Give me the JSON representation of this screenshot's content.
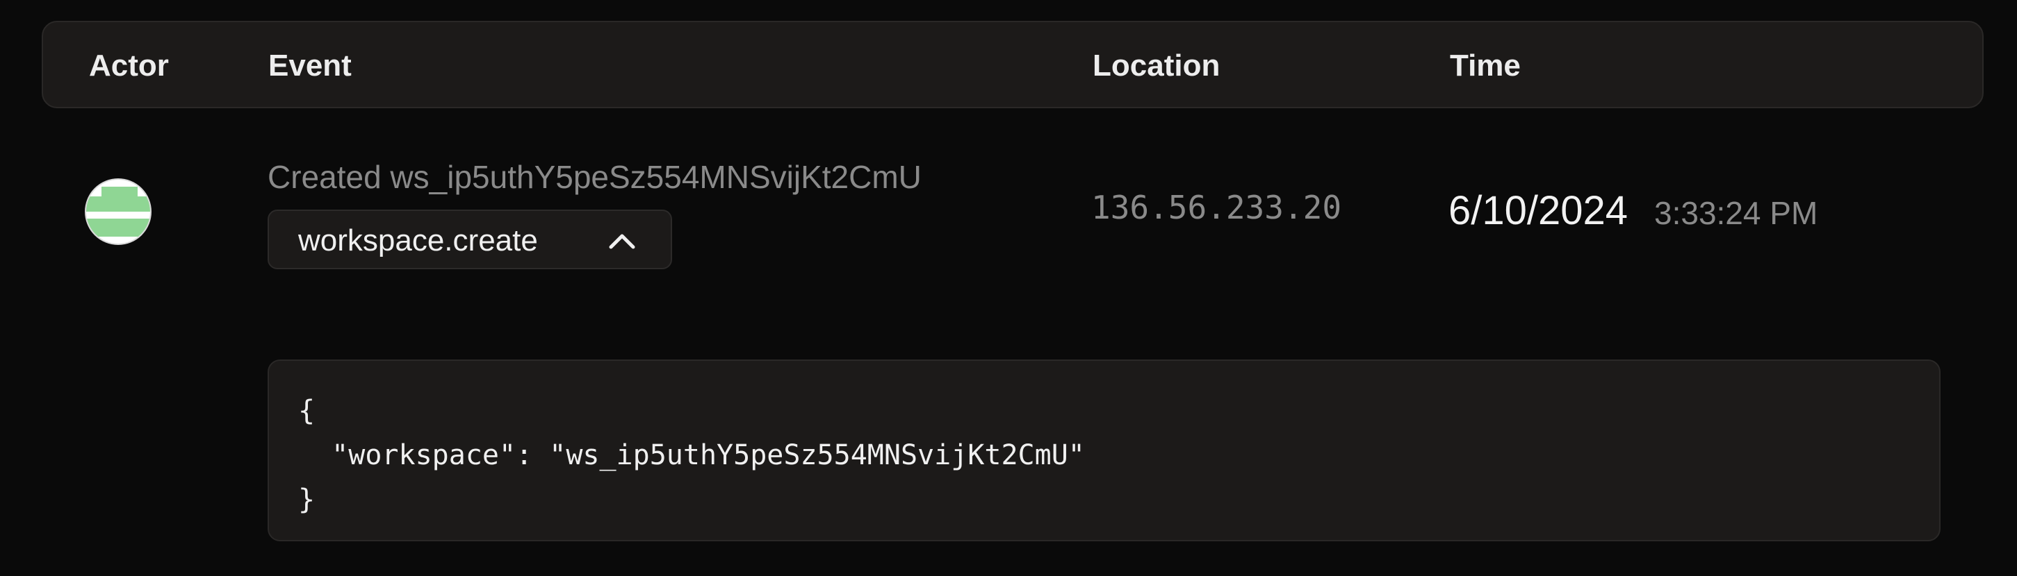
{
  "table": {
    "columns": {
      "actor": "Actor",
      "event": "Event",
      "location": "Location",
      "time": "Time"
    },
    "rows": [
      {
        "actor_avatar": "identicon-avatar",
        "event_description": "Created ws_ip5uthY5peSz554MNSvijKt2CmU",
        "event_type": "workspace.create",
        "event_type_expanded": true,
        "event_toggle_icon": "chevron-up-icon",
        "location": "136.56.233.20",
        "date": "6/10/2024",
        "time": "3:33:24 PM",
        "payload": {
          "line1": "{",
          "line2": "  \"workspace\": \"ws_ip5uthY5peSz554MNSvijKt2CmU\"",
          "line3": "}"
        }
      }
    ]
  },
  "colors": {
    "background": "#0a0a0a",
    "panel": "#1c1a19",
    "border": "#2a2827",
    "text_primary": "#ededed",
    "text_muted": "#8a8a8a",
    "avatar_green": "#8fd694"
  }
}
